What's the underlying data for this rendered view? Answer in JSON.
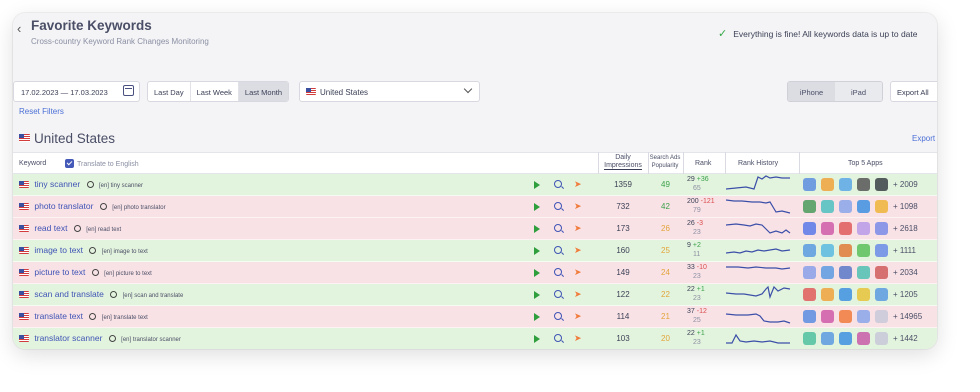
{
  "header": {
    "back_icon": "chevron-left-icon",
    "title": "Favorite Keywords",
    "subtitle": "Cross-country Keyword Rank Changes Monitoring",
    "status": "Everything is fine! All keywords data is up to date"
  },
  "filters": {
    "date_from": "17.02.2023",
    "date_sep": "—",
    "date_to": "17.03.2023",
    "periods": [
      "Last Day",
      "Last Week",
      "Last Month"
    ],
    "active_period": "Last Month",
    "country": "United States",
    "devices": [
      "iPhone",
      "iPad"
    ],
    "active_device": "iPhone",
    "export_all": "Export All",
    "reset": "Reset Filters"
  },
  "section": {
    "title": "United States",
    "export": "Export"
  },
  "columns": {
    "keyword": "Keyword",
    "translate": "Translate to English",
    "impressions_1": "Daily",
    "impressions_2": "Impressions",
    "popularity_1": "Search Ads",
    "popularity_2": "Popularity",
    "rank": "Rank",
    "history": "Rank History",
    "apps": "Top 5 Apps"
  },
  "colors": {
    "green_row": "#e3f4de",
    "red_row": "#f9e2e6",
    "link": "#3e53b5",
    "up": "#3aa14a",
    "down": "#d94c4c"
  },
  "rows": [
    {
      "keyword": "tiny scanner",
      "translation": "[en] tiny scanner",
      "impressions": "1359",
      "popularity": "49",
      "rank": "29",
      "change": "+36",
      "prev": "65",
      "delta": "+ 2009",
      "trend": "green"
    },
    {
      "keyword": "photo translator",
      "translation": "[en] photo translator",
      "impressions": "732",
      "popularity": "42",
      "rank": "200",
      "change": "-121",
      "prev": "79",
      "delta": "+ 1098",
      "trend": "red"
    },
    {
      "keyword": "read text",
      "translation": "[en] read text",
      "impressions": "173",
      "popularity": "26",
      "rank": "26",
      "change": "-3",
      "prev": "23",
      "delta": "+ 2618",
      "trend": "red"
    },
    {
      "keyword": "image to text",
      "translation": "[en] image to text",
      "impressions": "160",
      "popularity": "25",
      "rank": "9",
      "change": "+2",
      "prev": "11",
      "delta": "+ 1111",
      "trend": "green"
    },
    {
      "keyword": "picture to text",
      "translation": "[en] picture to text",
      "impressions": "149",
      "popularity": "24",
      "rank": "33",
      "change": "-10",
      "prev": "23",
      "delta": "+ 2034",
      "trend": "red"
    },
    {
      "keyword": "scan and translate",
      "translation": "[en] scan and translate",
      "impressions": "122",
      "popularity": "22",
      "rank": "22",
      "change": "+1",
      "prev": "23",
      "delta": "+ 1205",
      "trend": "green"
    },
    {
      "keyword": "translate text",
      "translation": "[en] translate text",
      "impressions": "114",
      "popularity": "21",
      "rank": "37",
      "change": "-12",
      "prev": "25",
      "delta": "+ 14965",
      "trend": "red"
    },
    {
      "keyword": "translator scanner",
      "translation": "[en] translator scanner",
      "impressions": "103",
      "popularity": "20",
      "rank": "22",
      "change": "+1",
      "prev": "23",
      "delta": "+ 1442",
      "trend": "green"
    }
  ]
}
